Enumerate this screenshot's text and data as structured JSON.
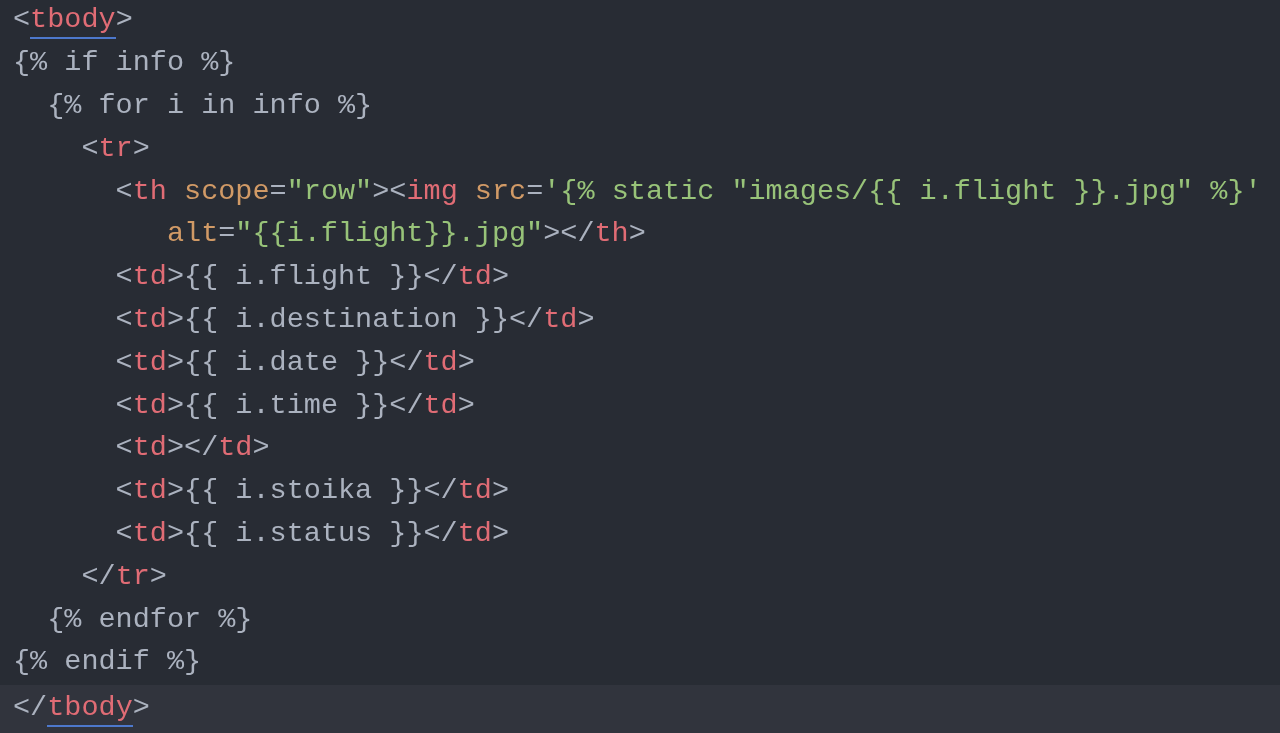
{
  "editor": {
    "lines": [
      {
        "current": false,
        "tokens": [
          {
            "kind": "punct",
            "text": "<"
          },
          {
            "kind": "tag",
            "text": "tbody",
            "matched": true
          },
          {
            "kind": "punct",
            "text": ">"
          }
        ]
      },
      {
        "current": false,
        "tokens": [
          {
            "kind": "punct",
            "text": "{% if info %}"
          }
        ]
      },
      {
        "current": false,
        "tokens": [
          {
            "kind": "punct",
            "text": "  {% for i in info %}"
          }
        ]
      },
      {
        "current": false,
        "tokens": [
          {
            "kind": "punct",
            "text": "    <"
          },
          {
            "kind": "tag",
            "text": "tr"
          },
          {
            "kind": "punct",
            "text": ">"
          }
        ]
      },
      {
        "current": false,
        "tokens": [
          {
            "kind": "punct",
            "text": "      <"
          },
          {
            "kind": "tag",
            "text": "th"
          },
          {
            "kind": "attr",
            "text": " scope"
          },
          {
            "kind": "punct",
            "text": "="
          },
          {
            "kind": "string",
            "text": "\"row\""
          },
          {
            "kind": "punct",
            "text": "><"
          },
          {
            "kind": "tag",
            "text": "img"
          },
          {
            "kind": "attr",
            "text": " src"
          },
          {
            "kind": "punct",
            "text": "="
          },
          {
            "kind": "string",
            "text": "'{% static \"images/{{ i.flight }}.jpg\" %}'"
          }
        ]
      },
      {
        "current": false,
        "tokens": [
          {
            "kind": "attr",
            "text": "         alt"
          },
          {
            "kind": "punct",
            "text": "="
          },
          {
            "kind": "string",
            "text": "\"{{i.flight}}.jpg\""
          },
          {
            "kind": "punct",
            "text": "></"
          },
          {
            "kind": "tag",
            "text": "th"
          },
          {
            "kind": "punct",
            "text": ">"
          }
        ]
      },
      {
        "current": false,
        "tokens": [
          {
            "kind": "punct",
            "text": "      <"
          },
          {
            "kind": "tag",
            "text": "td"
          },
          {
            "kind": "punct",
            "text": ">{{ i.flight }}</"
          },
          {
            "kind": "tag",
            "text": "td"
          },
          {
            "kind": "punct",
            "text": ">"
          }
        ]
      },
      {
        "current": false,
        "tokens": [
          {
            "kind": "punct",
            "text": "      <"
          },
          {
            "kind": "tag",
            "text": "td"
          },
          {
            "kind": "punct",
            "text": ">{{ i.destination }}</"
          },
          {
            "kind": "tag",
            "text": "td"
          },
          {
            "kind": "punct",
            "text": ">"
          }
        ]
      },
      {
        "current": false,
        "tokens": [
          {
            "kind": "punct",
            "text": "      <"
          },
          {
            "kind": "tag",
            "text": "td"
          },
          {
            "kind": "punct",
            "text": ">{{ i.date }}</"
          },
          {
            "kind": "tag",
            "text": "td"
          },
          {
            "kind": "punct",
            "text": ">"
          }
        ]
      },
      {
        "current": false,
        "tokens": [
          {
            "kind": "punct",
            "text": "      <"
          },
          {
            "kind": "tag",
            "text": "td"
          },
          {
            "kind": "punct",
            "text": ">{{ i.time }}</"
          },
          {
            "kind": "tag",
            "text": "td"
          },
          {
            "kind": "punct",
            "text": ">"
          }
        ]
      },
      {
        "current": false,
        "tokens": [
          {
            "kind": "punct",
            "text": "      <"
          },
          {
            "kind": "tag",
            "text": "td"
          },
          {
            "kind": "punct",
            "text": "></"
          },
          {
            "kind": "tag",
            "text": "td"
          },
          {
            "kind": "punct",
            "text": ">"
          }
        ]
      },
      {
        "current": false,
        "tokens": [
          {
            "kind": "punct",
            "text": "      <"
          },
          {
            "kind": "tag",
            "text": "td"
          },
          {
            "kind": "punct",
            "text": ">{{ i.stoika }}</"
          },
          {
            "kind": "tag",
            "text": "td"
          },
          {
            "kind": "punct",
            "text": ">"
          }
        ]
      },
      {
        "current": false,
        "tokens": [
          {
            "kind": "punct",
            "text": "      <"
          },
          {
            "kind": "tag",
            "text": "td"
          },
          {
            "kind": "punct",
            "text": ">{{ i.status }}</"
          },
          {
            "kind": "tag",
            "text": "td"
          },
          {
            "kind": "punct",
            "text": ">"
          }
        ]
      },
      {
        "current": false,
        "tokens": [
          {
            "kind": "punct",
            "text": "    </"
          },
          {
            "kind": "tag",
            "text": "tr"
          },
          {
            "kind": "punct",
            "text": ">"
          }
        ]
      },
      {
        "current": false,
        "tokens": [
          {
            "kind": "punct",
            "text": "  {% endfor %}"
          }
        ]
      },
      {
        "current": false,
        "tokens": [
          {
            "kind": "punct",
            "text": "{% endif %}"
          }
        ]
      },
      {
        "current": true,
        "tokens": [
          {
            "kind": "punct",
            "text": "</"
          },
          {
            "kind": "tag",
            "text": "tbody",
            "matched": true
          },
          {
            "kind": "punct",
            "text": ">"
          }
        ]
      }
    ]
  }
}
